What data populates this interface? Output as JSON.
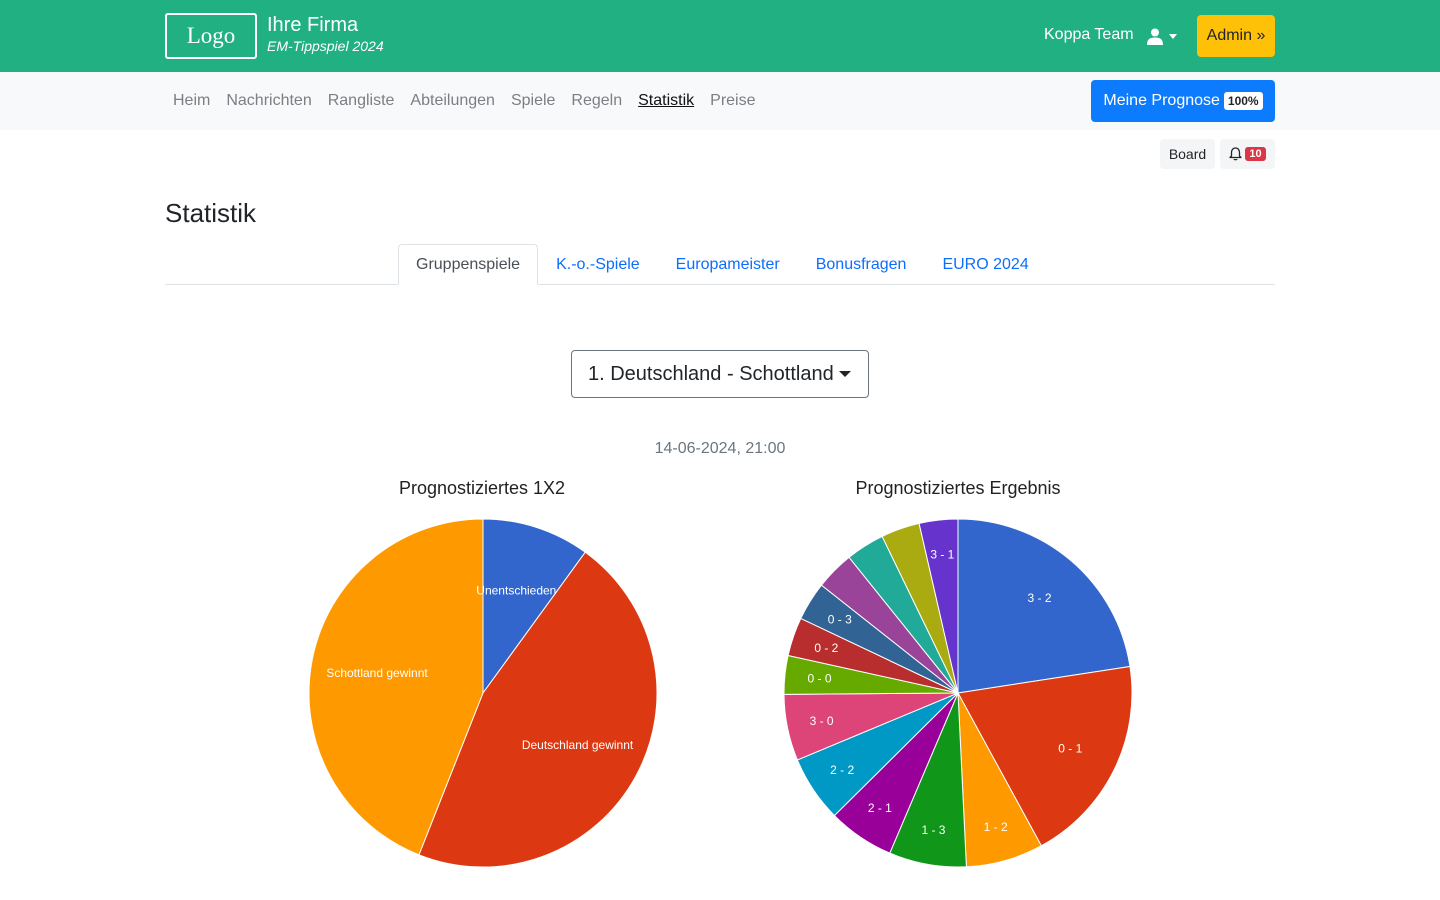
{
  "header": {
    "logo_text": "Logo",
    "brand_name": "Ihre Firma",
    "brand_subtitle": "EM-Tippspiel 2024",
    "team_name": "Koppa Team",
    "user_icon": "user-icon",
    "admin_label": "Admin »",
    "colors": {
      "bar": "#21b081",
      "admin": "#ffc107"
    }
  },
  "nav": {
    "items": [
      "Heim",
      "Nachrichten",
      "Rangliste",
      "Abteilungen",
      "Spiele",
      "Regeln",
      "Statistik",
      "Preise"
    ],
    "active": "Statistik",
    "forecast_label": "Meine Prognose",
    "forecast_badge": "100%"
  },
  "utility": {
    "board_label": "Board",
    "bell_icon": "bell-icon",
    "notification_count": "10"
  },
  "page": {
    "title": "Statistik",
    "tabs": [
      "Gruppenspiele",
      "K.-o.-Spiele",
      "Europameister",
      "Bonusfragen",
      "EURO 2024"
    ],
    "active_tab": "Gruppenspiele",
    "match_select_value": "1. Deutschland - Schottland",
    "match_date": "14-06-2024, 21:00"
  },
  "chart_data": [
    {
      "type": "pie",
      "title": "Prognostiziertes 1X2",
      "labels": [
        "Unentschieden",
        "Deutschland gewinnt",
        "Schottland gewinnt"
      ],
      "values": [
        10,
        46,
        44
      ],
      "colors": [
        "#3366cc",
        "#dc3912",
        "#ff9900"
      ]
    },
    {
      "type": "pie",
      "title": "Prognostiziertes Ergebnis",
      "labels": [
        "3 - 2",
        "0 - 1",
        "1 - 2",
        "1 - 3",
        "2 - 1",
        "2 - 2",
        "3 - 0",
        "0 - 0",
        "0 - 2",
        "0 - 3",
        "",
        "",
        "",
        "3 - 1"
      ],
      "values": [
        22,
        19,
        7,
        7,
        6,
        6,
        6,
        3.5,
        3.5,
        3.5,
        3.5,
        3.5,
        3.5,
        3.5
      ],
      "colors": [
        "#3366cc",
        "#dc3912",
        "#ff9900",
        "#109618",
        "#990099",
        "#0099c6",
        "#dd4477",
        "#66aa00",
        "#b82e2e",
        "#316395",
        "#994499",
        "#22aa99",
        "#aaaa11",
        "#6633cc"
      ]
    }
  ]
}
